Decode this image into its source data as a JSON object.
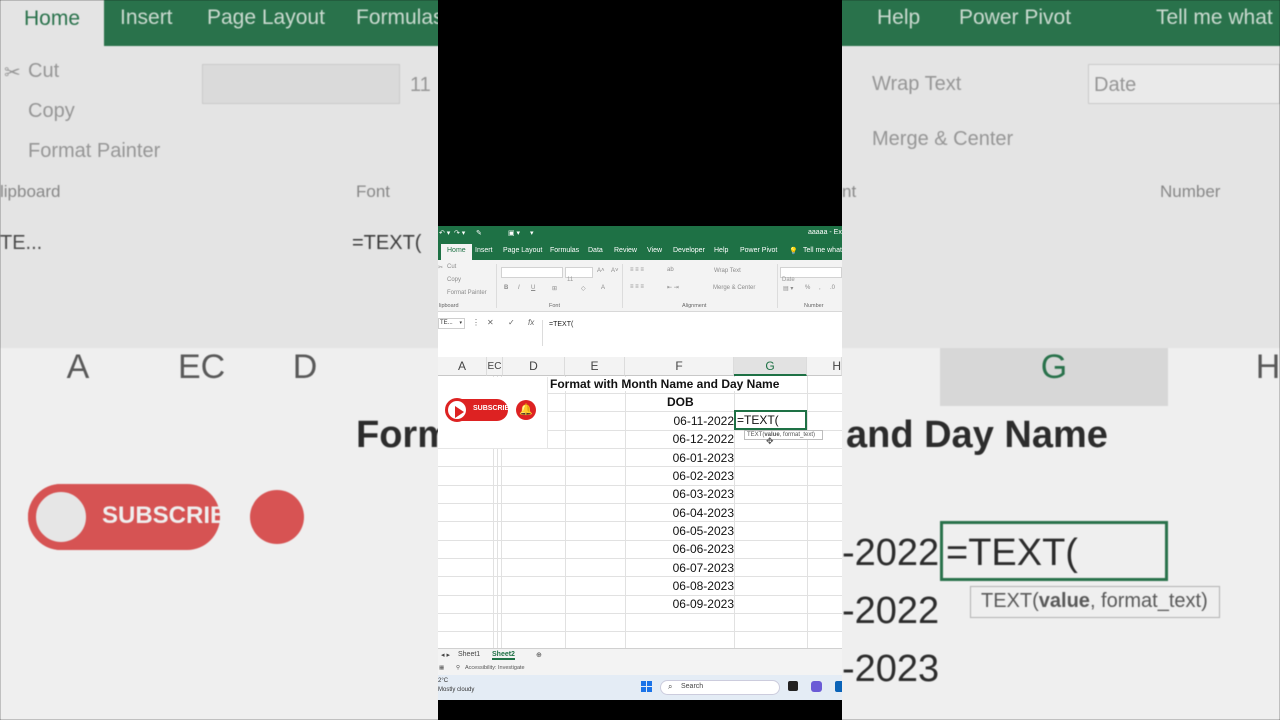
{
  "app": {
    "window_title": "aaaaa - Ex",
    "tabs": [
      "Home",
      "Insert",
      "Page Layout",
      "Formulas",
      "Data",
      "Review",
      "View",
      "Developer",
      "Help",
      "Power Pivot"
    ],
    "tell_me": "Tell me what",
    "active_tab": "Home"
  },
  "ribbon": {
    "cut": "Cut",
    "copy": "Copy",
    "format_painter": "Format Painter",
    "clipboard": "lipboard",
    "font_size": "11",
    "bold": "B",
    "italic": "I",
    "underline": "U",
    "font_group": "Font",
    "wrap_text": "Wrap Text",
    "merge_center": "Merge & Center",
    "alignment_group": "Alignment",
    "number_format": "Date",
    "percent": "%",
    "comma": ",",
    "number_group": "Number"
  },
  "formula_bar": {
    "name_box": "TE...",
    "cancel": "✕",
    "enter": "✓",
    "fx": "fx",
    "content": "=TEXT("
  },
  "columns": [
    "A",
    "EC",
    "D",
    "E",
    "F",
    "G",
    "H"
  ],
  "sheet": {
    "title": "Format with Month Name and Day Name",
    "header": "DOB",
    "dates": [
      "06-11-2022",
      "06-12-2022",
      "06-01-2023",
      "06-02-2023",
      "06-03-2023",
      "06-04-2023",
      "06-05-2023",
      "06-06-2023",
      "06-07-2023",
      "06-08-2023",
      "06-09-2023"
    ],
    "active_cell_text": "=TEXT(",
    "tooltip": {
      "prefix": "TEXT(",
      "bold": "value",
      "suffix": ", format_text)"
    }
  },
  "overlay": {
    "subscribe": "SUBSCRIBE",
    "bell": "🔔"
  },
  "sheet_tabs": [
    "Sheet1",
    "Sheet2"
  ],
  "active_sheet": "Sheet2",
  "status_bar": {
    "accessibility": "Accessibility: Investigate"
  },
  "taskbar": {
    "temp": "2°C",
    "weather": "Mostly cloudy",
    "search": "Search"
  },
  "background": {
    "tabs": [
      "Home",
      "Insert",
      "Page Layout",
      "Formulas",
      "Help",
      "Power Pivot",
      "Tell me what"
    ],
    "cut": "Cut",
    "copy": "Copy",
    "format_painter": "Format Painter",
    "clipboard": "lipboard",
    "font_size": "11",
    "font_group": "Font",
    "wrap_text": "Wrap Text",
    "merge_center": "Merge & Center",
    "alignment_group": "nt",
    "number_format": "Date",
    "number_group": "Number",
    "name_box": "TE...",
    "fx_content": "=TEXT(",
    "col_a": "A",
    "col_ec": "EC",
    "col_d": "D",
    "col_g": "G",
    "col_h": "H",
    "title_left": "Form",
    "title_right": "and Day Name",
    "date1": "-2022",
    "date2": "-2022",
    "date3": "-2023",
    "active_text": "=TEXT(",
    "tooltip_prefix": "TEXT(",
    "tooltip_bold": "value",
    "tooltip_suffix": ", format_text)",
    "subscribe": "SUBSCRIBE"
  },
  "colors": {
    "excel_green": "#1e7145",
    "youtube_red": "#dd2222"
  }
}
